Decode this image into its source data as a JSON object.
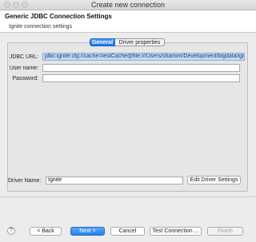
{
  "window": {
    "title": "Create new connection"
  },
  "header": {
    "title": "Generic JDBC Connection Settings",
    "subtitle": "Ignite connection settings"
  },
  "tabs": [
    {
      "label": "General",
      "active": true
    },
    {
      "label": "Driver properties",
      "active": false
    }
  ],
  "form": {
    "jdbc_url_label": "JDBC URL:",
    "jdbc_url_value": "jdbc:ignite:cfg://cache=testCache@file:///Users/shamim/Development/bigdata/ignite/",
    "username_label": "User name:",
    "username_value": "",
    "password_label": "Password:",
    "password_value": ""
  },
  "driver": {
    "label": "Driver Name:",
    "value": "Ignite",
    "edit_button": "Edit Driver Settings"
  },
  "footer": {
    "help": "?",
    "back": "< Back",
    "next": "Next >",
    "cancel": "Cancel",
    "test": "Test Connection ...",
    "finish": "Finish"
  },
  "colors": {
    "accent": "#1c74e8",
    "url_highlight": "#c3d9f5"
  }
}
